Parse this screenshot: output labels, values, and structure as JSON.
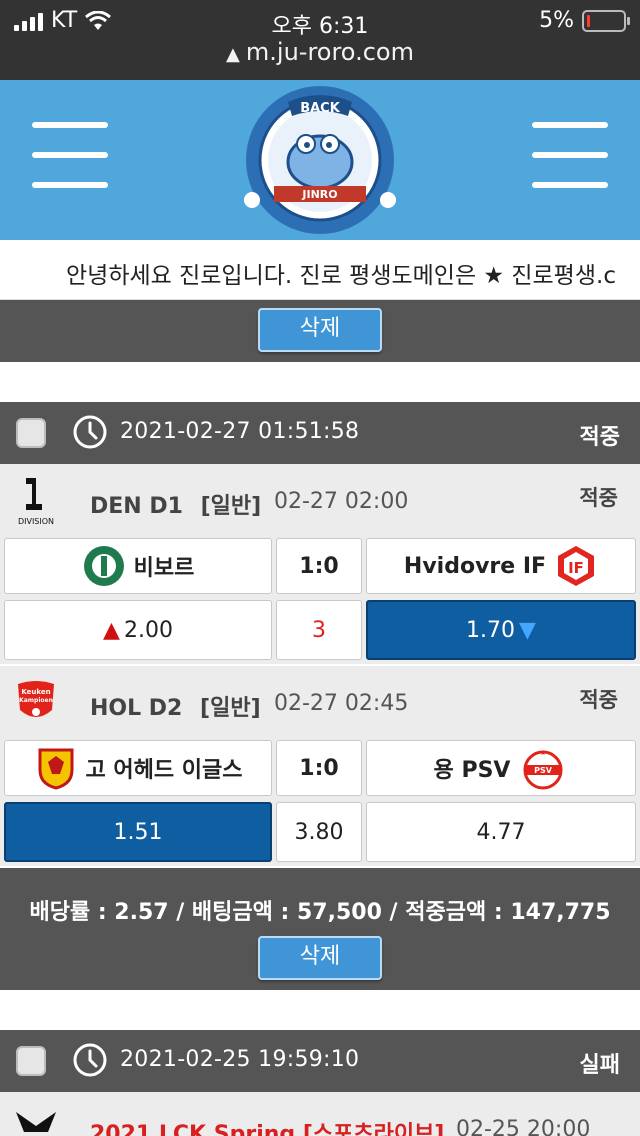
{
  "status": {
    "carrier": "KT",
    "time": "오후 6:31",
    "battery": "5%"
  },
  "url": "m.ju-roro.com",
  "notice": "안녕하세요 진로입니다. 진로 평생도메인은 ★ 진로평생.c",
  "delete_label": "삭제",
  "bets": [
    {
      "date": "2021-02-27 01:51:58",
      "result": "적중",
      "matches": [
        {
          "league": "DEN D1",
          "type": "[일반]",
          "time": "02-27 02:00",
          "result": "적중",
          "home": "비보르",
          "away": "Hvidovre IF",
          "score": "1:0",
          "odds_home": "2.00",
          "odds_draw": "3",
          "odds_away": "1.70"
        },
        {
          "league": "HOL D2",
          "type": "[일반]",
          "time": "02-27 02:45",
          "result": "적중",
          "home": "고 어헤드 이글스",
          "away": "용 PSV",
          "score": "1:0",
          "odds_home": "1.51",
          "odds_draw": "3.80",
          "odds_away": "4.77"
        }
      ],
      "summary": "배당률 : 2.57 / 배팅금액 : 57,500 / 적중금액 : 147,775"
    },
    {
      "date": "2021-02-25 19:59:10",
      "result": "실패",
      "matches": [
        {
          "league": "2021 LCK Spring [스포츠라이브]",
          "time": "02-25 20:00"
        }
      ]
    }
  ],
  "colors": {
    "header": "#4fa7dc",
    "band": "#555555",
    "selected": "#0f5ea2",
    "button": "#3f95d6"
  }
}
